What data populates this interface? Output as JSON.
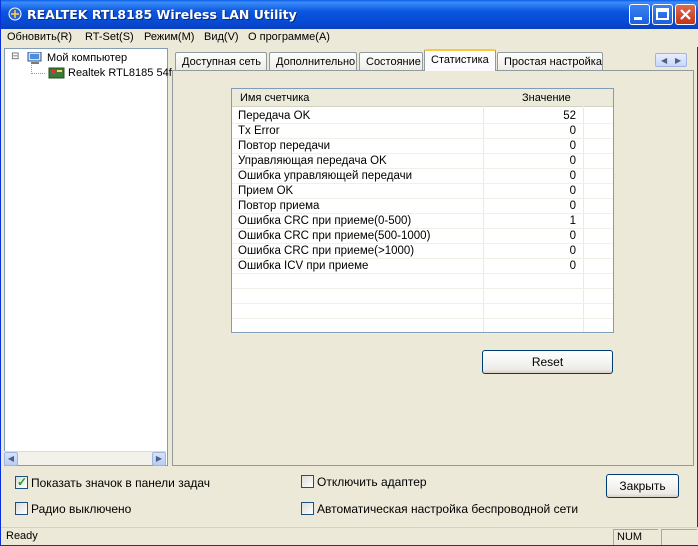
{
  "window": {
    "title": "REALTEK RTL8185 Wireless LAN Utility"
  },
  "menu": [
    {
      "label": "Обновить(R)"
    },
    {
      "label": "RT-Set(S)"
    },
    {
      "label": "Режим(M)"
    },
    {
      "label": "Вид(V)"
    },
    {
      "label": "О программе(A)"
    }
  ],
  "tree": {
    "expander": "⊟",
    "root": "Мой компьютер",
    "child": "Realtek RTL8185 54f"
  },
  "tabs": [
    {
      "label": "Доступная сеть"
    },
    {
      "label": "Дополнительно"
    },
    {
      "label": "Состояние"
    },
    {
      "label": "Статистика"
    },
    {
      "label": "Простая настройка"
    }
  ],
  "stats": {
    "col_name": "Имя счетчика",
    "col_value": "Значение",
    "rows": [
      {
        "name": "Передача OK",
        "value": "52"
      },
      {
        "name": "Tx Error",
        "value": "0"
      },
      {
        "name": "Повтор передачи",
        "value": "0"
      },
      {
        "name": "Управляющая передача OK",
        "value": "0"
      },
      {
        "name": "Ошибка управляющей передачи",
        "value": "0"
      },
      {
        "name": "Прием OK",
        "value": "0"
      },
      {
        "name": "Повтор приема",
        "value": "0"
      },
      {
        "name": "Ошибка CRC при приеме(0-500)",
        "value": "1"
      },
      {
        "name": "Ошибка CRC при приеме(500-1000)",
        "value": "0"
      },
      {
        "name": "Ошибка CRC при приеме(>1000)",
        "value": "0"
      },
      {
        "name": "Ошибка ICV при приеме",
        "value": "0"
      }
    ]
  },
  "buttons": {
    "reset": "Reset",
    "close": "Закрыть"
  },
  "options": {
    "show_tray_icon": {
      "label": "Показать значок в панели задач",
      "checked": true
    },
    "radio_off": {
      "label": "Радио выключено",
      "checked": false
    },
    "disable_adapter": {
      "label": "Отключить адаптер",
      "checked": false
    },
    "auto_config": {
      "label": "Автоматическая настройка беспроводной сети",
      "checked": false
    }
  },
  "status": {
    "text": "Ready",
    "num": "NUM"
  },
  "colors": {
    "titlebar": "#0a5de8",
    "active_tab_accent": "#ffc83c",
    "check_mark": "#21a121"
  }
}
